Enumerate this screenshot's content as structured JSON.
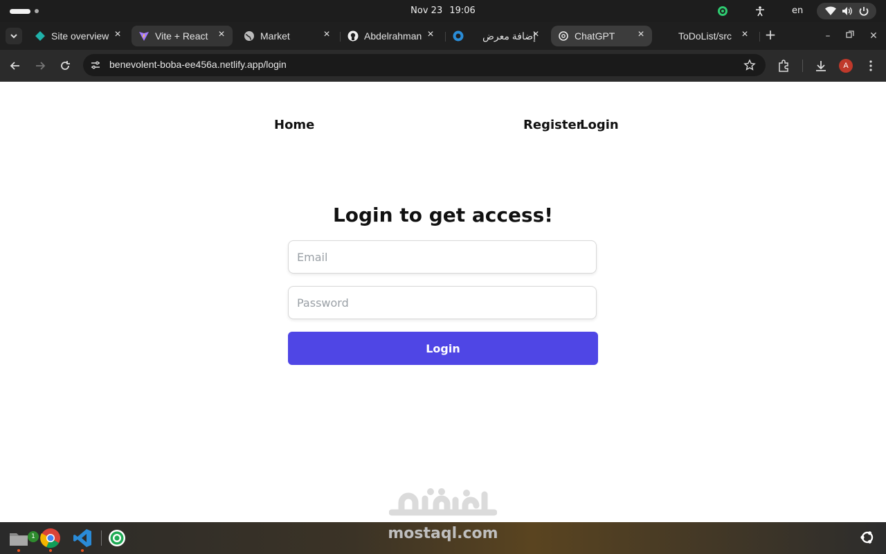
{
  "os": {
    "date": "Nov 23",
    "time": "19:06",
    "language": "en"
  },
  "tabs": [
    {
      "title": "Site overview",
      "icon": "netlify-icon"
    },
    {
      "title": "Vite + React",
      "icon": "vite-icon"
    },
    {
      "title": "Market",
      "icon": "globe-icon"
    },
    {
      "title": "Abdelrahman",
      "icon": "github-icon"
    },
    {
      "title": "إضافة معرض",
      "icon": "mostaql-icon"
    },
    {
      "title": "ChatGPT",
      "icon": "chatgpt-icon"
    },
    {
      "title": "ToDoList/src",
      "icon": "blank-icon"
    }
  ],
  "browser": {
    "url": "benevolent-boba-ee456a.netlify.app/login",
    "profile_initial": "A"
  },
  "site": {
    "nav_home": "Home",
    "nav_register": "Register",
    "nav_login": "Login",
    "heading": "Login to get access!",
    "email_placeholder": "Email",
    "password_placeholder": "Password",
    "login_button": "Login"
  },
  "watermark": {
    "text": "mostaql.com"
  },
  "taskbar": {
    "files_badge": "1"
  }
}
